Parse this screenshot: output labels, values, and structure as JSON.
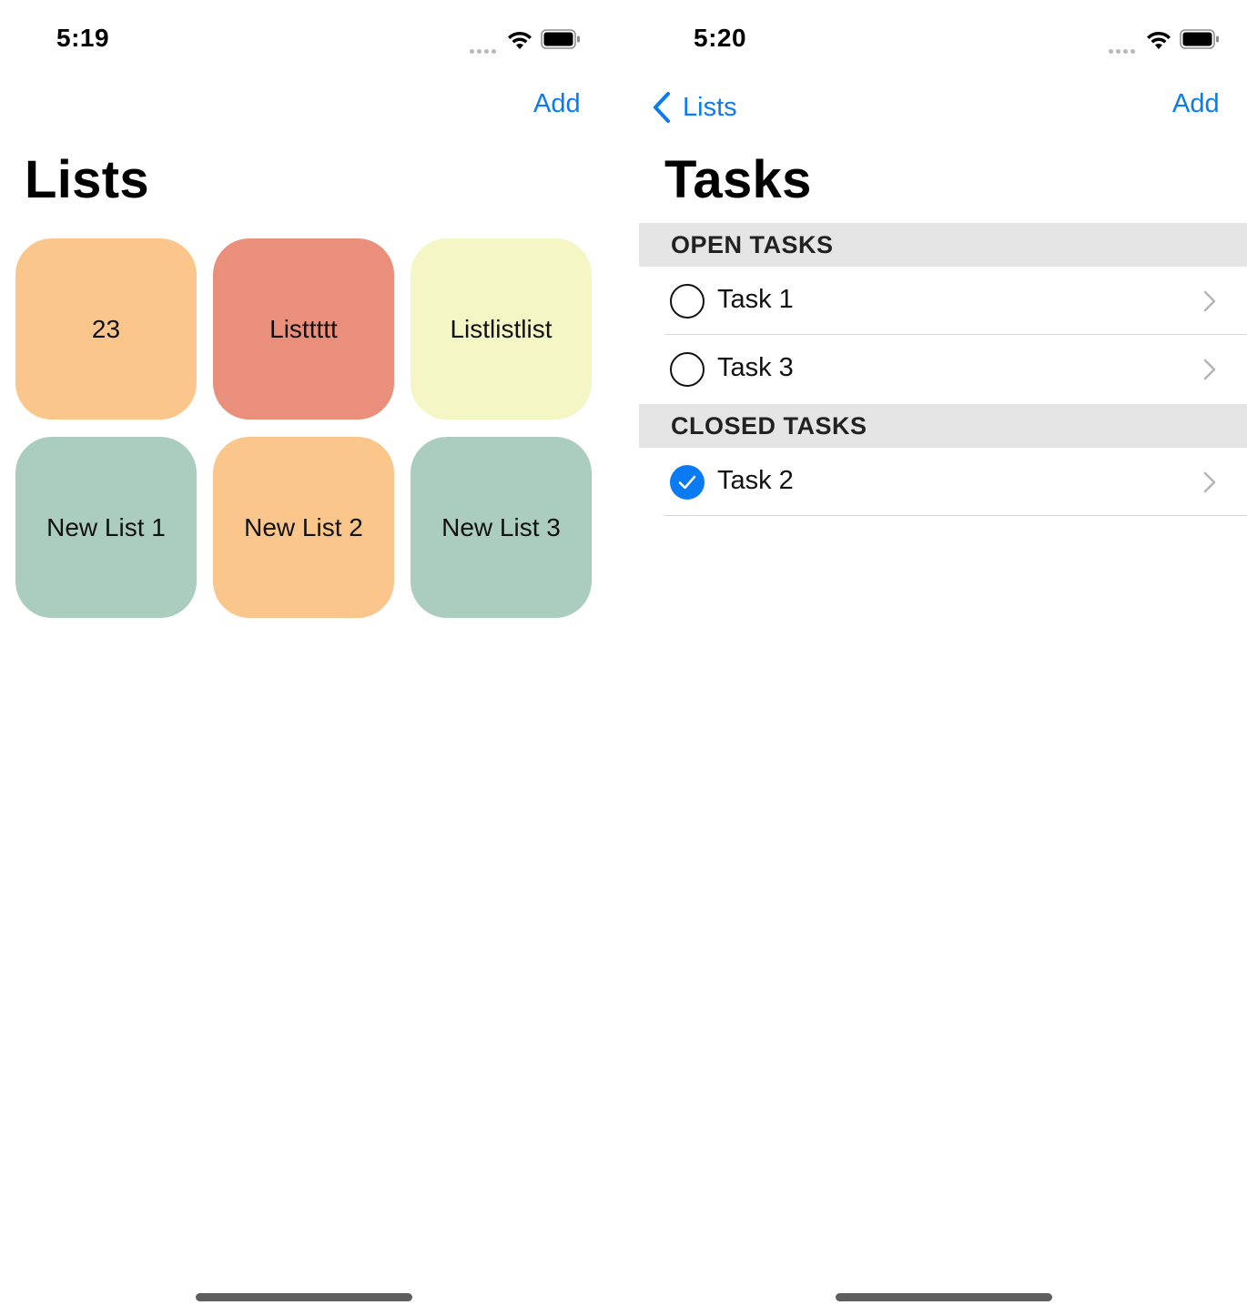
{
  "left_screen": {
    "status": {
      "time": "5:19"
    },
    "nav": {
      "add_label": "Add"
    },
    "title": "Lists",
    "tiles": [
      {
        "label": "23",
        "color": "#fbc68b"
      },
      {
        "label": "Listtttt",
        "color": "#ea8f7b"
      },
      {
        "label": "Listlistlist",
        "color": "#f4f6c5"
      },
      {
        "label": "New List 1",
        "color": "#abcdbf"
      },
      {
        "label": "New List 2",
        "color": "#fbc68b"
      },
      {
        "label": "New List 3",
        "color": "#abcdbf"
      }
    ]
  },
  "right_screen": {
    "status": {
      "time": "5:20"
    },
    "nav": {
      "back_label": "Lists",
      "add_label": "Add"
    },
    "title": "Tasks",
    "sections": [
      {
        "header": "OPEN TASKS",
        "tasks": [
          {
            "label": "Task 1",
            "completed": false
          },
          {
            "label": "Task 3",
            "completed": false
          }
        ]
      },
      {
        "header": "CLOSED TASKS",
        "tasks": [
          {
            "label": "Task 2",
            "completed": true
          }
        ]
      }
    ]
  },
  "colors": {
    "accent": "#0a7bf2",
    "section_header_bg": "#e5e5e5",
    "separator": "#d6d6d6"
  },
  "icons": {
    "status_bar": [
      "cellular-signal-icon",
      "wifi-icon",
      "battery-icon"
    ],
    "back": "chevron-left-icon",
    "disclosure": "chevron-right-icon",
    "open_task": "empty-circle-icon",
    "closed_task": "checkmark-circle-icon"
  }
}
